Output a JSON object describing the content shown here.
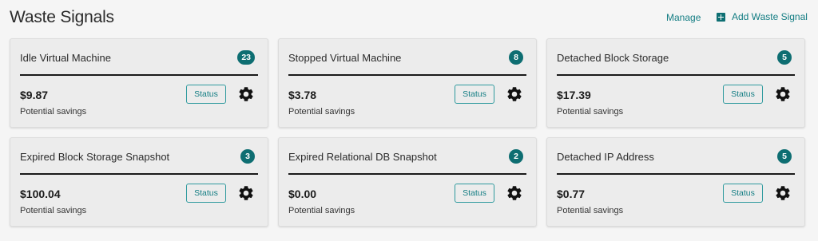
{
  "header": {
    "title": "Waste Signals",
    "manage_label": "Manage",
    "add_label": "Add Waste Signal"
  },
  "cards": [
    {
      "title": "Idle Virtual Machine",
      "count": "23",
      "amount": "$9.87",
      "subtext": "Potential savings",
      "status_label": "Status",
      "icon": "gear-icon"
    },
    {
      "title": "Stopped Virtual Machine",
      "count": "8",
      "amount": "$3.78",
      "subtext": "Potential savings",
      "status_label": "Status",
      "icon": "gear-icon"
    },
    {
      "title": "Detached Block Storage",
      "count": "5",
      "amount": "$17.39",
      "subtext": "Potential savings",
      "status_label": "Status",
      "icon": "gear-icon"
    },
    {
      "title": "Expired Block Storage Snapshot",
      "count": "3",
      "amount": "$100.04",
      "subtext": "Potential savings",
      "status_label": "Status",
      "icon": "gear-icon"
    },
    {
      "title": "Expired Relational DB Snapshot",
      "count": "2",
      "amount": "$0.00",
      "subtext": "Potential savings",
      "status_label": "Status",
      "icon": "gear-icon"
    },
    {
      "title": "Detached IP Address",
      "count": "5",
      "amount": "$0.77",
      "subtext": "Potential savings",
      "status_label": "Status",
      "icon": "gear-icon"
    }
  ],
  "colors": {
    "accent": "#0e6e72",
    "link": "#137d83",
    "card_bg": "#ececec",
    "page_bg": "#f5f5f5"
  }
}
